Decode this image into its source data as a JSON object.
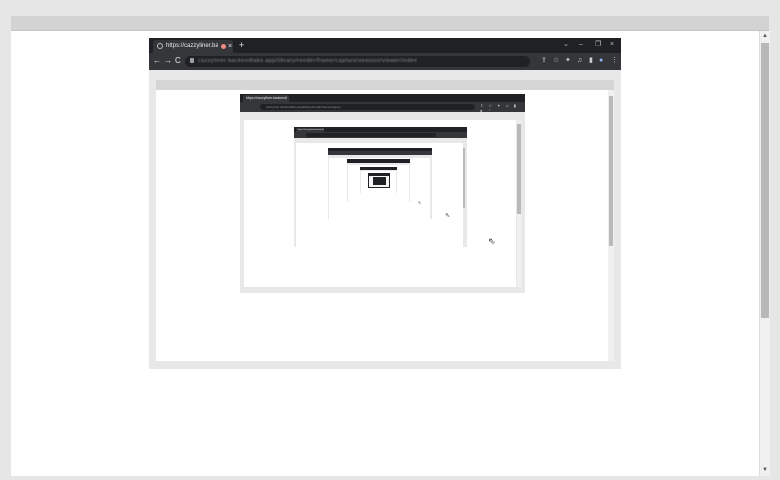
{
  "outer": {
    "scroll_up_arrow": "▲",
    "scroll_down_arrow": "▼"
  },
  "browser": {
    "tab_title": "https://cazzyliner.backendl",
    "tab_close": "×",
    "new_tab": "+",
    "window_controls": {
      "tab_search": "⌄",
      "minimize": "–",
      "restore": "❐",
      "close": "×"
    },
    "nav": {
      "back": "←",
      "forward": "→",
      "reload": "C"
    },
    "url": "cazzyliner.backendlabs.app/library/render/frame/capture/session/viewer/index",
    "toolbar_icons": {
      "share": "⇪",
      "star": "☆",
      "extensions": "✦",
      "media": "♫",
      "sidebar": "▮",
      "profile": "●",
      "menu": "⋮"
    }
  },
  "nested": {
    "level2_tab_title": "https://cazzyliner.backendl",
    "level2_url": "cazzyliner.backendlabs.app/library/render/frame/capture",
    "level2_icons": "⇪ ☆ ✦ ♫ ▮ ● ⋮",
    "level3_tab_title": "https://cazzyliner.backendl"
  },
  "cursors": {
    "pointer": "⇖"
  }
}
